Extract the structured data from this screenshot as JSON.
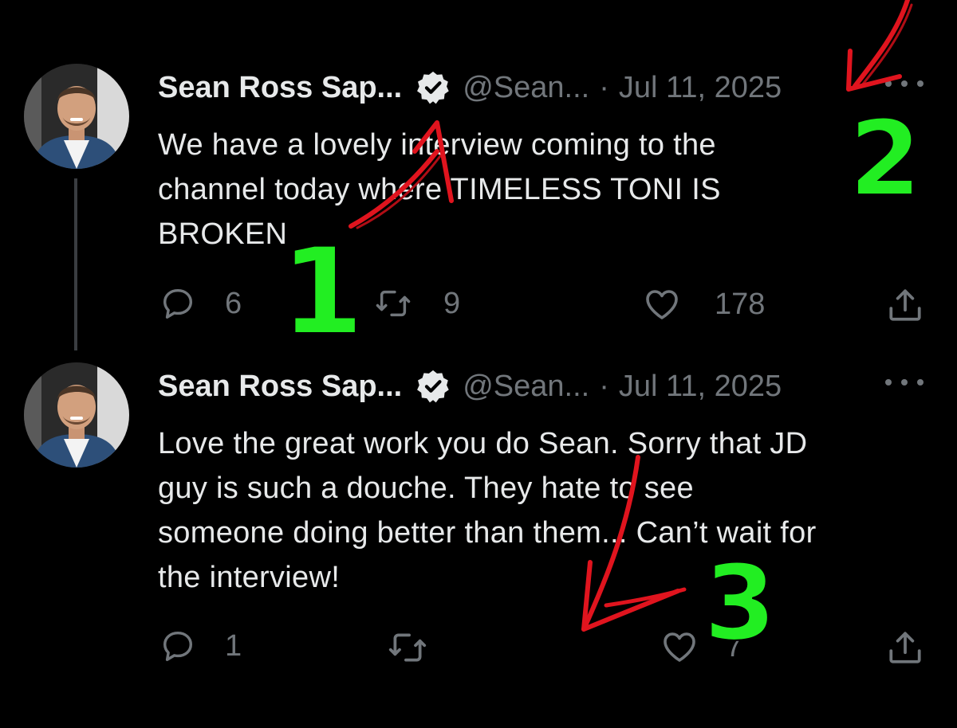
{
  "tweets": [
    {
      "author_name": "Sean Ross Sap...",
      "handle": "@Sean...",
      "separator": "·",
      "date": "Jul 11, 2025",
      "text_lines": [
        "We have a lovely interview coming to the",
        "channel today where TIMELESS TONI IS",
        "BROKEN"
      ],
      "replies": "6",
      "retweets": "9",
      "likes": "178"
    },
    {
      "author_name": "Sean Ross Sap...",
      "handle": "@Sean...",
      "separator": "·",
      "date": "Jul 11, 2025",
      "text_lines": [
        "Love the great work you do Sean. Sorry that JD",
        "guy is such a douche. They hate to see",
        "someone doing better than them... Can’t wait for",
        "the interview!"
      ],
      "replies": "1",
      "retweets": "",
      "likes": "7"
    }
  ],
  "annotations": {
    "number_1": "1",
    "number_2": "2",
    "number_3": "3",
    "number_color": "#22ee22",
    "arrow_color": "#e0141e"
  },
  "icons": {
    "verified": "verified-badge-icon",
    "more": "more-icon",
    "reply": "reply-icon",
    "retweet": "retweet-icon",
    "like": "like-icon",
    "share": "share-icon"
  }
}
